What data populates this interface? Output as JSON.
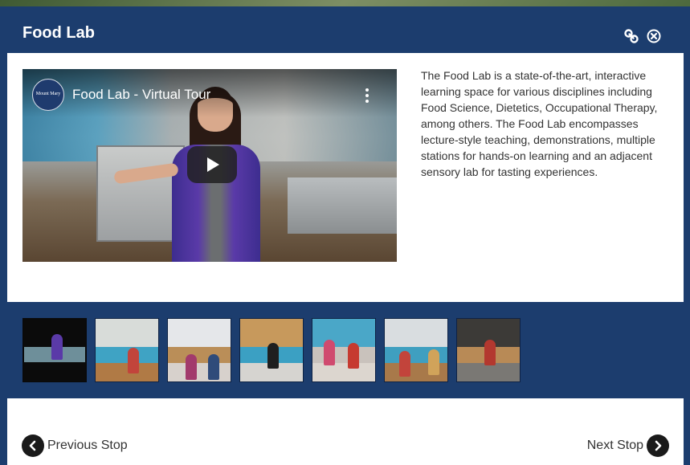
{
  "modal": {
    "title": "Food Lab",
    "description": "The Food Lab is a state-of-the-art, interactive learning space for various disciplines including Food Science, Dietetics, Occupational Therapy, among others. The Food Lab encompasses lecture-style teaching, demonstrations, multiple stations for hands-on learning and an adjacent sensory lab for tasting experiences.",
    "header_icons": [
      "link-icon",
      "close-icon"
    ]
  },
  "video": {
    "title": "Food Lab - Virtual Tour",
    "channel_logo_text": "Mount Mary",
    "icons": [
      "play-icon",
      "more-options-icon"
    ]
  },
  "thumbnails": [
    {
      "selected": true
    },
    {
      "selected": false
    },
    {
      "selected": false
    },
    {
      "selected": false
    },
    {
      "selected": false
    },
    {
      "selected": false
    },
    {
      "selected": false
    }
  ],
  "footer": {
    "previous_label": "Previous Stop",
    "next_label": "Next Stop"
  },
  "colors": {
    "header_bg": "#1c3d6e",
    "panel_bg": "#ffffff",
    "text": "#333333",
    "nav_circle": "#1a1a1a"
  }
}
